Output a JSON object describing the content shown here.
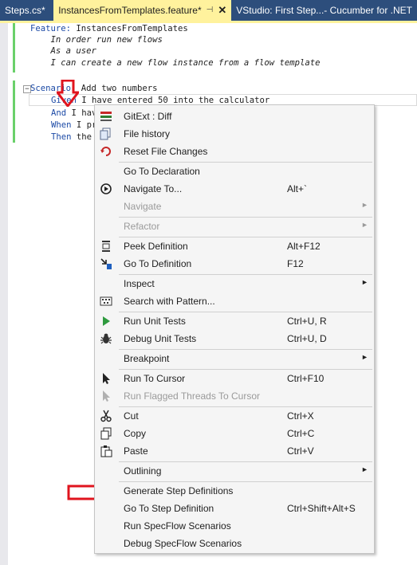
{
  "tabs": [
    {
      "label": "Steps.cs*"
    },
    {
      "label": "InstancesFromTemplates.feature*",
      "pin": "⊣",
      "close": "✕"
    },
    {
      "label": "VStudio: First Step...- Cucumber for .NET"
    }
  ],
  "editor": {
    "lines": [
      {
        "kw": "Feature:",
        "text": " InstancesFromTemplates"
      },
      {
        "text": "    In order run new flows"
      },
      {
        "text": "    As a user"
      },
      {
        "text": "    I can create a new flow instance from a flow template"
      },
      {
        "kw": "Scenario:",
        "text": " Add two numbers"
      },
      {
        "kw": "Given",
        "text": " I have entered 50 into the calculator"
      },
      {
        "kw": "And",
        "text": " I hav"
      },
      {
        "kw": "When",
        "text": " I pr"
      },
      {
        "kw": "Then",
        "text": " the"
      }
    ]
  },
  "menu": {
    "items": [
      {
        "label": "GitExt : Diff",
        "icon": "diff-icon"
      },
      {
        "label": "File history",
        "icon": "file-history-icon"
      },
      {
        "label": "Reset File Changes",
        "icon": "reset-icon"
      },
      {
        "label": "Go To Declaration"
      },
      {
        "label": "Navigate To...",
        "shortcut": "Alt+`",
        "icon": "navigate-icon"
      },
      {
        "label": "Navigate",
        "disabled": true,
        "submenu": true
      },
      {
        "label": "Refactor",
        "disabled": true,
        "submenu": true
      },
      {
        "label": "Peek Definition",
        "shortcut": "Alt+F12",
        "icon": "peek-icon"
      },
      {
        "label": "Go To Definition",
        "shortcut": "F12",
        "icon": "goto-def-icon"
      },
      {
        "label": "Inspect",
        "submenu": true
      },
      {
        "label": "Search with Pattern...",
        "icon": "pattern-icon"
      },
      {
        "label": "Run Unit Tests",
        "shortcut": "Ctrl+U, R",
        "icon": "play-icon"
      },
      {
        "label": "Debug Unit Tests",
        "shortcut": "Ctrl+U, D",
        "icon": "bug-icon"
      },
      {
        "label": "Breakpoint",
        "submenu": true
      },
      {
        "label": "Run To Cursor",
        "shortcut": "Ctrl+F10",
        "icon": "cursor-icon"
      },
      {
        "label": "Run Flagged Threads To Cursor",
        "disabled": true,
        "icon": "cursor-disabled-icon"
      },
      {
        "label": "Cut",
        "shortcut": "Ctrl+X",
        "icon": "scissors-icon"
      },
      {
        "label": "Copy",
        "shortcut": "Ctrl+C",
        "icon": "copy-icon"
      },
      {
        "label": "Paste",
        "shortcut": "Ctrl+V",
        "icon": "paste-icon"
      },
      {
        "label": "Outlining",
        "submenu": true
      },
      {
        "label": "Generate Step Definitions"
      },
      {
        "label": "Go To Step Definition",
        "shortcut": "Ctrl+Shift+Alt+S"
      },
      {
        "label": "Run SpecFlow Scenarios"
      },
      {
        "label": "Debug SpecFlow Scenarios"
      }
    ],
    "submenu_glyph": "►"
  },
  "colors": {
    "accent": "#fff29d",
    "tabstrip": "#2d4e7c",
    "keyword": "#1c4aa6",
    "arrow": "#e0141e"
  }
}
